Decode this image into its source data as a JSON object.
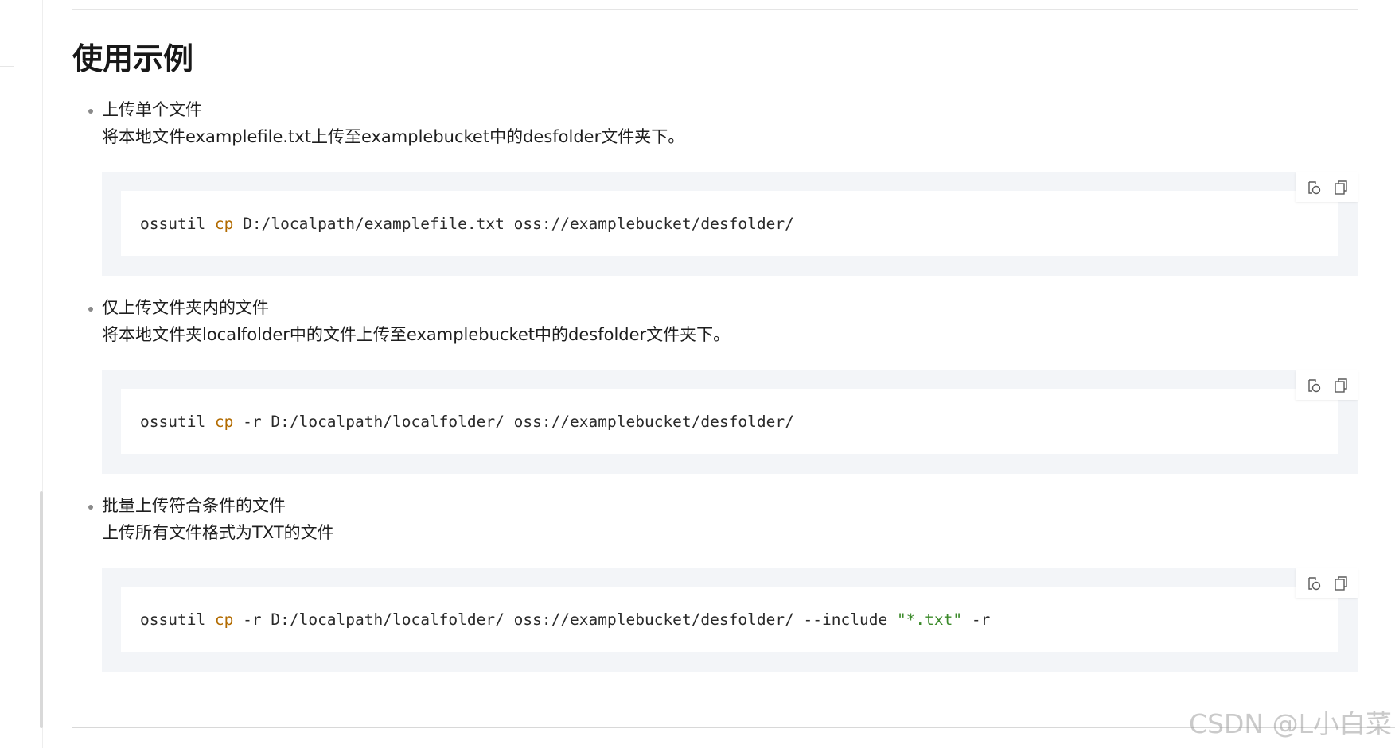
{
  "heading": "使用示例",
  "items": [
    {
      "title": "上传单个文件",
      "description": "将本地文件examplefile.txt上传至examplebucket中的desfolder文件夹下。",
      "code": {
        "cmd": "ossutil ",
        "keyword": "cp",
        "rest": " D:/localpath/examplefile.txt oss://examplebucket/desfolder/",
        "string": "",
        "tail": ""
      }
    },
    {
      "title": "仅上传文件夹内的文件",
      "description": "将本地文件夹localfolder中的文件上传至examplebucket中的desfolder文件夹下。",
      "code": {
        "cmd": "ossutil ",
        "keyword": "cp",
        "rest": " -r D:/localpath/localfolder/ oss://examplebucket/desfolder/",
        "string": "",
        "tail": ""
      }
    },
    {
      "title": "批量上传符合条件的文件",
      "description": "上传所有文件格式为TXT的文件",
      "code": {
        "cmd": "ossutil ",
        "keyword": "cp",
        "rest": " -r D:/localpath/localfolder/ oss://examplebucket/desfolder/ --include ",
        "string": "\"*.txt\"",
        "tail": " -r"
      }
    }
  ],
  "toolbar": {
    "run_icon": "run-in-cloud-shell-icon",
    "copy_icon": "copy-icon"
  },
  "watermark": "CSDN @L小白菜",
  "colors": {
    "code_bg": "#f3f5f8",
    "keyword": "#b26b00",
    "string": "#3b8a2a"
  }
}
